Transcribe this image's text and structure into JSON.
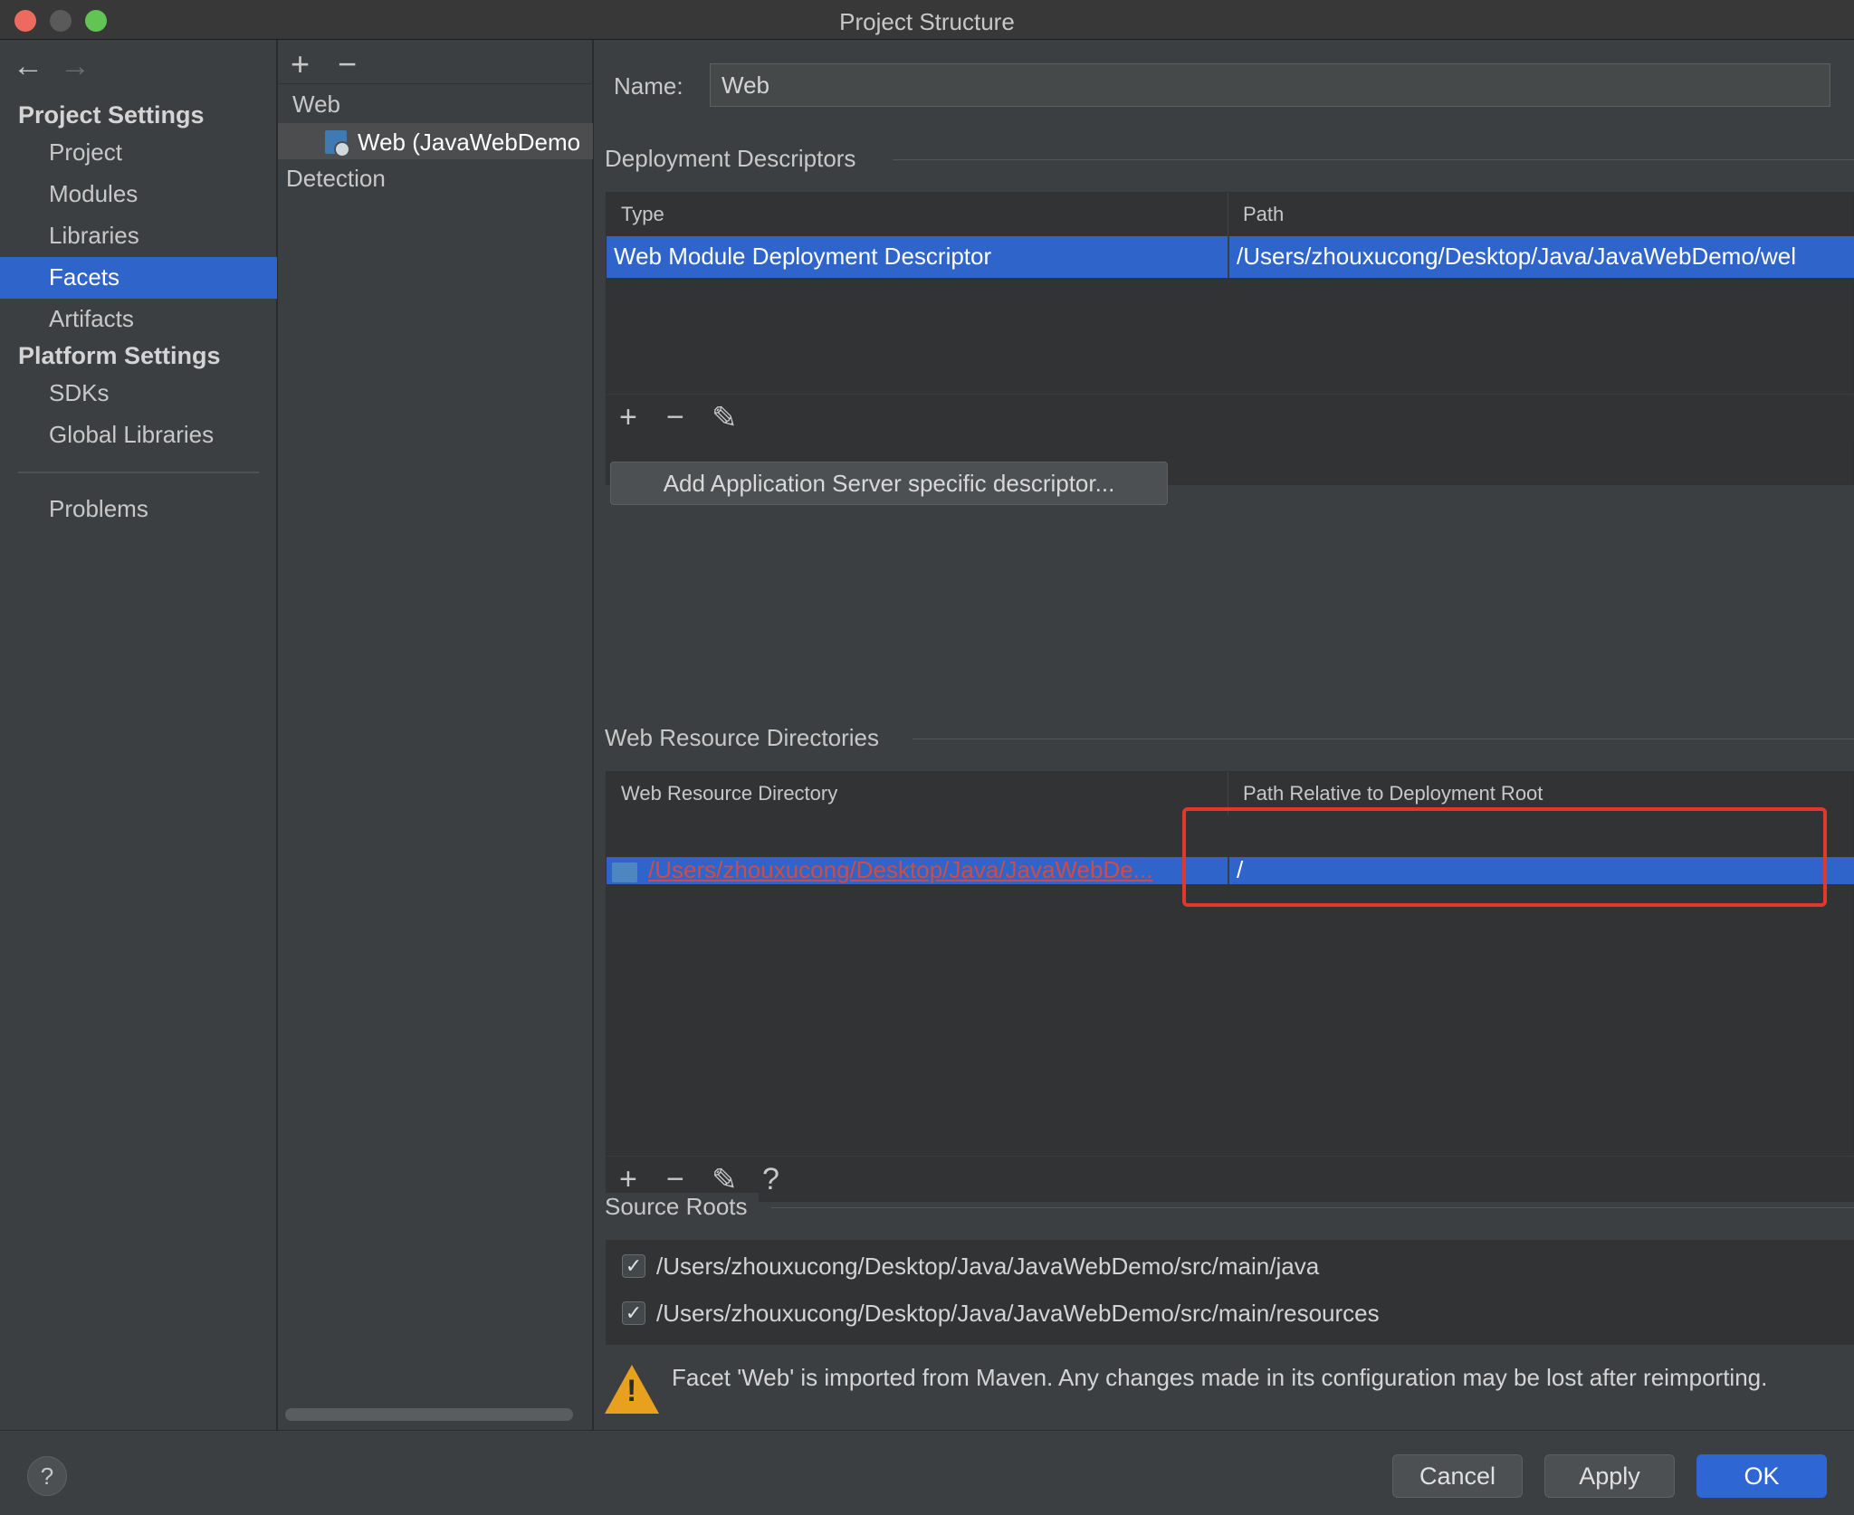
{
  "window": {
    "title": "Project Structure"
  },
  "sidebar": {
    "project_settings_heading": "Project Settings",
    "project_items": [
      "Project",
      "Modules",
      "Libraries",
      "Facets",
      "Artifacts"
    ],
    "selected": "Facets",
    "platform_settings_heading": "Platform Settings",
    "platform_items": [
      "SDKs",
      "Global Libraries"
    ],
    "problems": "Problems"
  },
  "middle": {
    "add_icon": "+",
    "remove_icon": "−",
    "tree_root": "Web",
    "tree_child": "Web (JavaWebDemo",
    "detection": "Detection"
  },
  "main": {
    "name_label": "Name:",
    "name_value": "Web",
    "deployment": {
      "title": "Deployment Descriptors",
      "headers": [
        "Type",
        "Path"
      ],
      "row": {
        "type": "Web Module Deployment Descriptor",
        "path": "/Users/zhouxucong/Desktop/Java/JavaWebDemo/wel"
      },
      "add_server_button": "Add Application Server specific descriptor..."
    },
    "web_resources": {
      "title": "Web Resource Directories",
      "headers": [
        "Web Resource Directory",
        "Path Relative to Deployment Root"
      ],
      "row": {
        "directory": "/Users/zhouxucong/Desktop/Java/JavaWebDe...",
        "relative": "/"
      }
    },
    "source_roots": {
      "title": "Source Roots",
      "items": [
        "/Users/zhouxucong/Desktop/Java/JavaWebDemo/src/main/java",
        "/Users/zhouxucong/Desktop/Java/JavaWebDemo/src/main/resources"
      ]
    },
    "warning": "Facet 'Web' is imported from Maven. Any changes made in its configuration may be lost after reimporting."
  },
  "buttons": {
    "help": "?",
    "cancel": "Cancel",
    "apply": "Apply",
    "ok": "OK"
  },
  "toolbar_icons": {
    "add": "+",
    "remove": "−",
    "edit": "✎",
    "help": "?"
  },
  "colors": {
    "selection": "#2f65ca",
    "ok_button": "#2e67d3",
    "highlight_box": "#e0392c",
    "warning": "#e8a11f"
  }
}
